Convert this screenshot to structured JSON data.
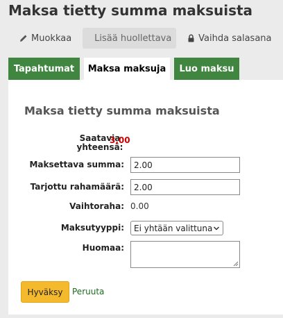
{
  "page": {
    "title": "Maksa tietty summa maksuista"
  },
  "toolbar": {
    "edit_label": "Muokkaa",
    "add_guarantor_label": "Lisää huollettava",
    "change_password_label": "Vaihda salasana"
  },
  "tabs": [
    {
      "label": "Tapahtumat",
      "active": false
    },
    {
      "label": "Maksa maksuja",
      "active": true
    },
    {
      "label": "Luo maksu",
      "active": false
    }
  ],
  "form": {
    "title": "Maksa tietty summa maksuista",
    "total_label": "Saatavia yhteensä:",
    "total_value": "3,00",
    "amount_label": "Maksettava summa:",
    "amount_value": "2.00",
    "tendered_label": "Tarjottu rahamäärä:",
    "tendered_value": "2.00",
    "change_label": "Vaihtoraha:",
    "change_value": "0.00",
    "payment_type_label": "Maksutyyppi:",
    "payment_type_value": "Ei yhtään valittuna",
    "note_label": "Huomaa:",
    "note_value": "",
    "submit_label": "Hyväksy",
    "cancel_label": "Peruuta"
  },
  "colors": {
    "tab_green": "#408540",
    "total_red": "#cc0000",
    "submit_yellow": "#f5b92d",
    "link_green": "#1d6b1d"
  }
}
